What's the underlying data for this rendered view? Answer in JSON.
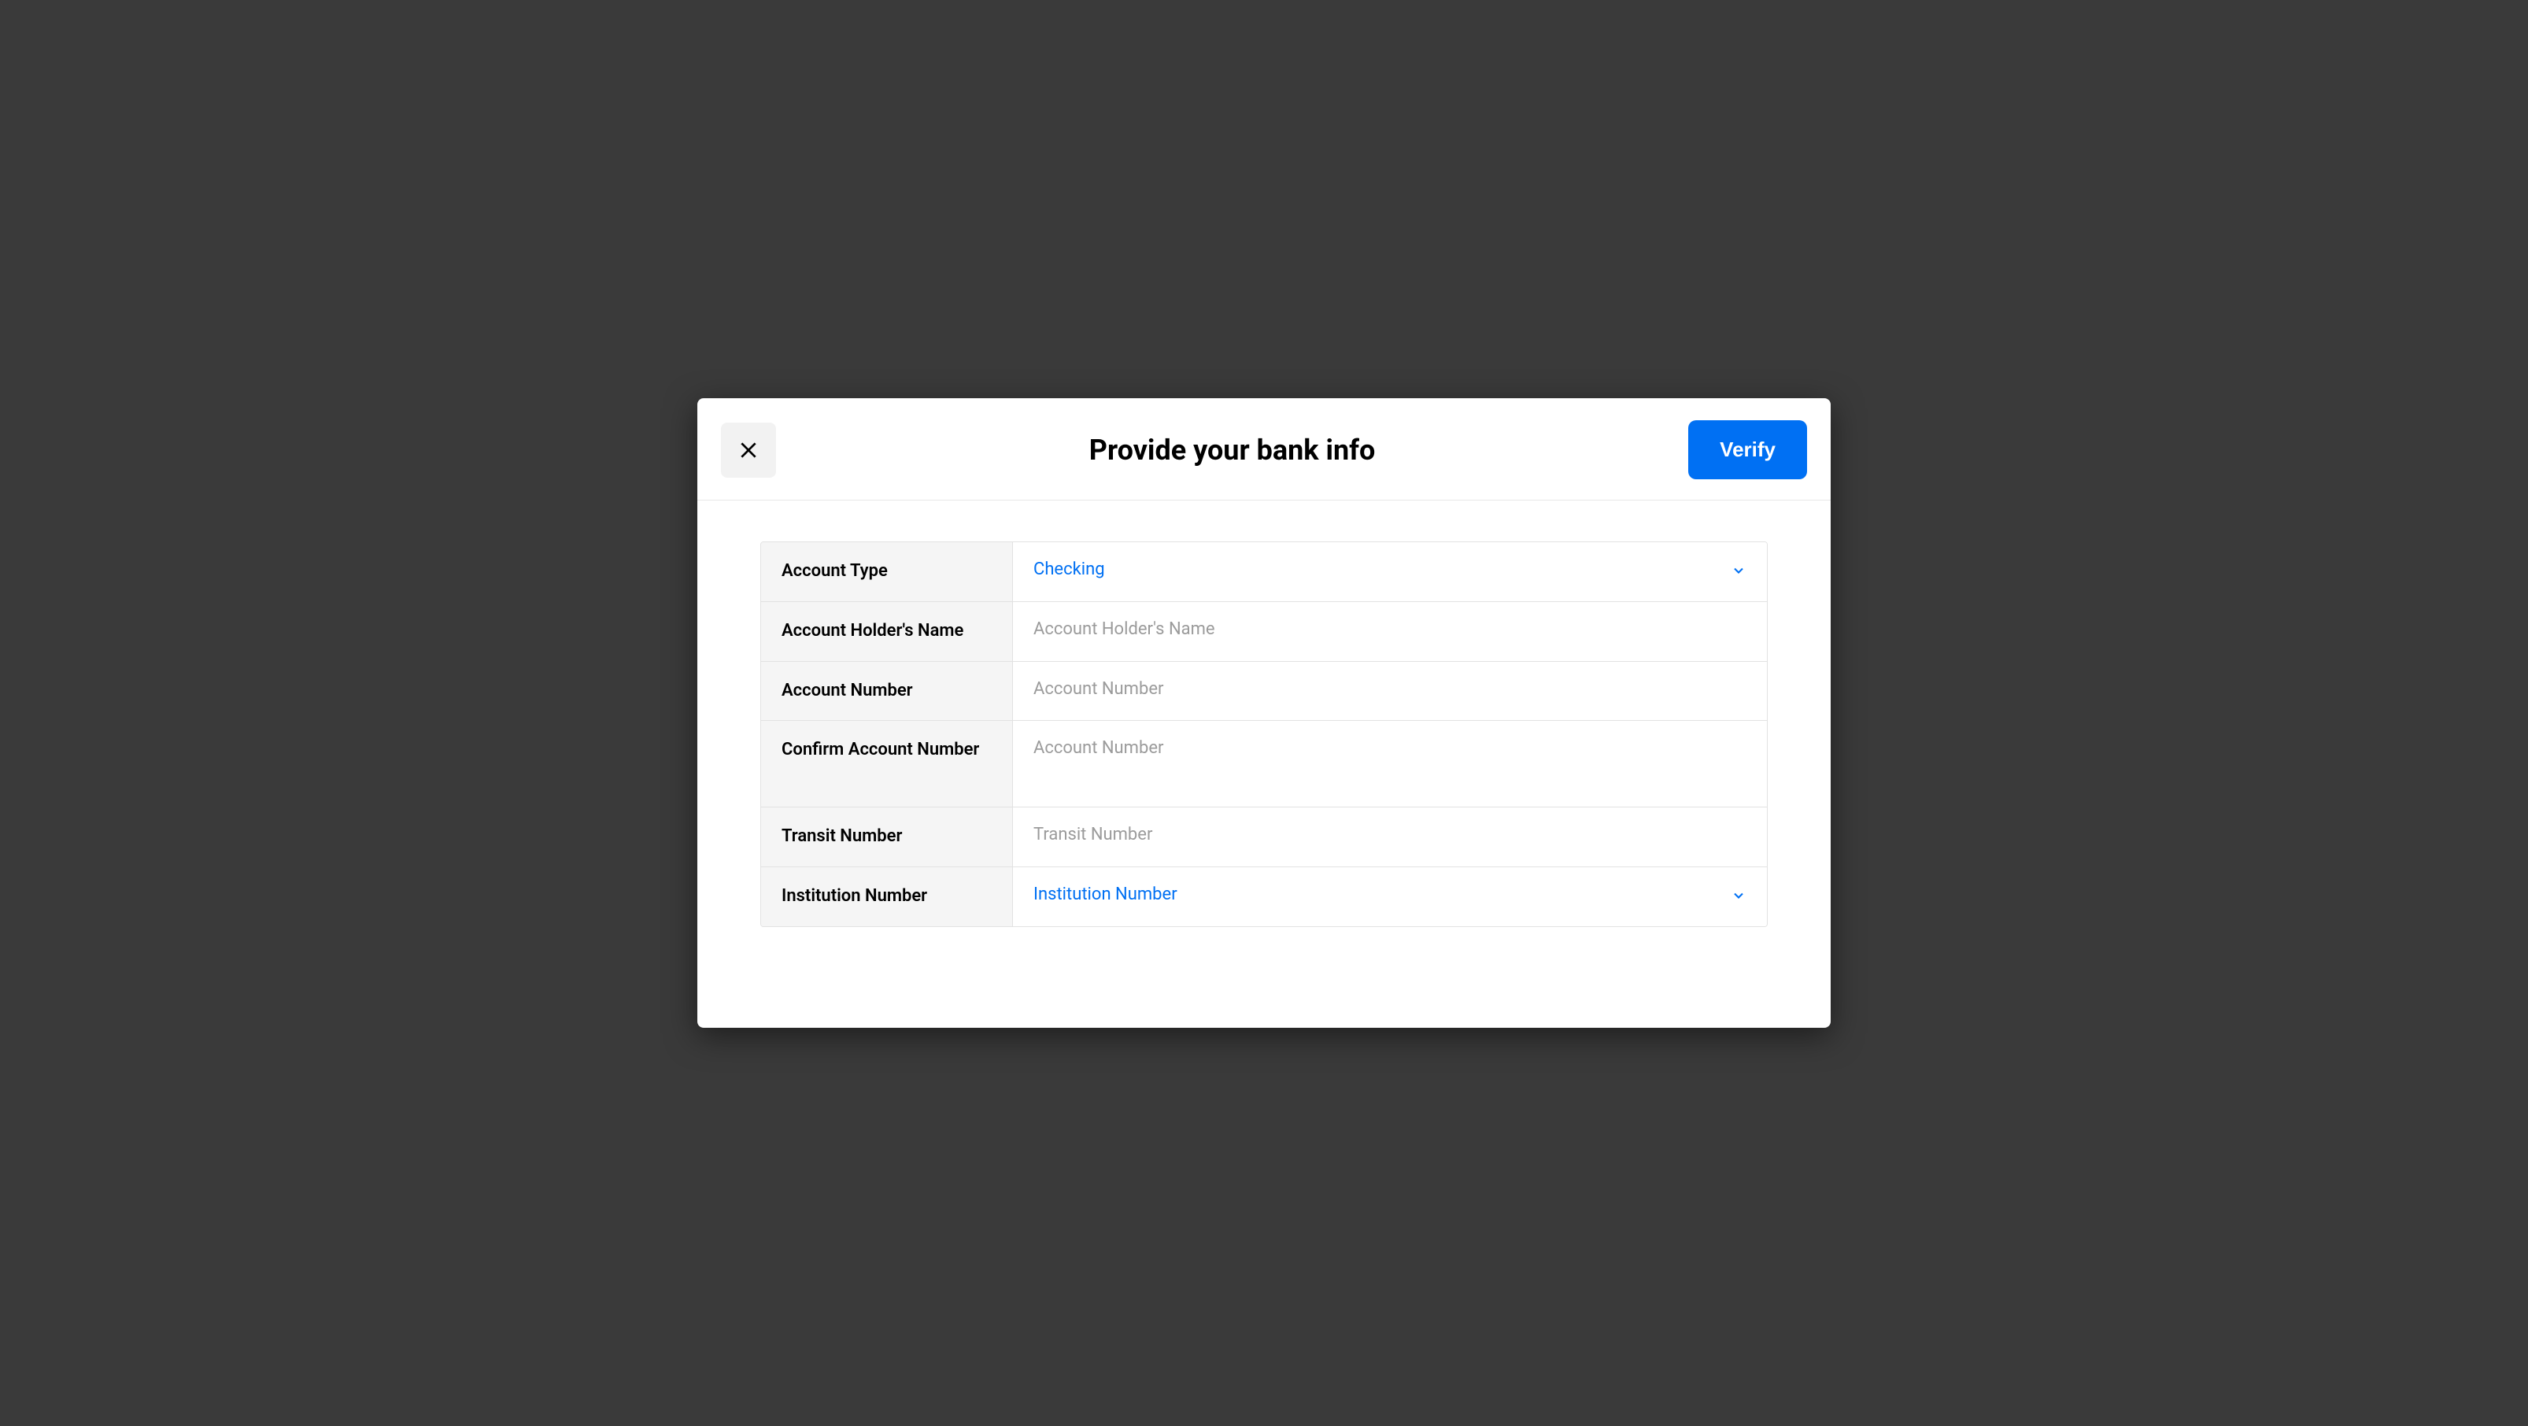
{
  "header": {
    "title": "Provide your bank info",
    "verify_label": "Verify"
  },
  "form": {
    "account_type": {
      "label": "Account Type",
      "value": "Checking"
    },
    "account_holder_name": {
      "label": "Account Holder's Name",
      "placeholder": "Account Holder's Name",
      "value": ""
    },
    "account_number": {
      "label": "Account Number",
      "placeholder": "Account Number",
      "value": ""
    },
    "confirm_account_number": {
      "label": "Confirm Account Number",
      "placeholder": "Account Number",
      "value": ""
    },
    "transit_number": {
      "label": "Transit Number",
      "placeholder": "Transit Number",
      "value": ""
    },
    "institution_number": {
      "label": "Institution Number",
      "placeholder": "Institution Number",
      "value": ""
    }
  }
}
